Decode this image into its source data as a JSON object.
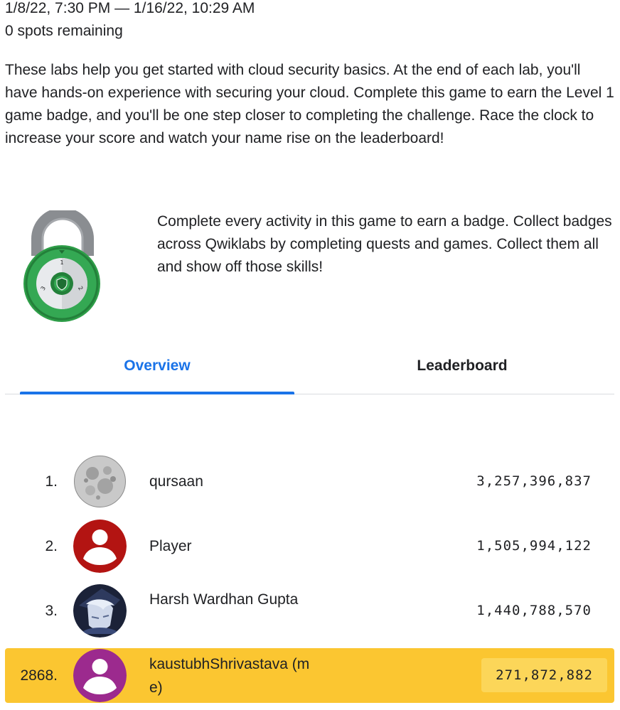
{
  "event": {
    "dates": "1/8/22, 7:30 PM — 1/16/22, 10:29 AM",
    "spots": "0 spots remaining",
    "description": "These labs help you get started with cloud security basics. At the end of each lab, you'll have hands-on experience with securing your cloud. Complete this game to earn the Level 1 game badge, and you'll be one step closer to completing the challenge. Race the clock to increase your score and watch your name rise on the leaderboard!"
  },
  "badge": {
    "icon": "padlock-badge-icon",
    "dial_numbers": [
      "1",
      "2",
      "3"
    ],
    "text": "Complete every activity in this game to earn a badge. Collect badges across Qwiklabs by completing quests and games. Collect them all and show off those skills!"
  },
  "tabs": [
    {
      "label": "Overview",
      "active": true
    },
    {
      "label": "Leaderboard",
      "active": false
    }
  ],
  "colors": {
    "accent": "#1a73e8",
    "highlight": "#fbc631",
    "badge_green": "#2e9e48"
  },
  "leaderboard": [
    {
      "rank": "1.",
      "name": "qursaan",
      "score": "3,257,396,837",
      "avatar": "moon-avatar-icon"
    },
    {
      "rank": "2.",
      "name": "Player",
      "score": "1,505,994,122",
      "avatar": "default-user-avatar-red-icon"
    },
    {
      "rank": "3.",
      "name": "Harsh Wardhan Gupta",
      "score": "1,440,788,570",
      "avatar": "anime-character-avatar-icon"
    },
    {
      "rank": "2868.",
      "name": "kaustubhShrivastava (me)",
      "score": "271,872,882",
      "avatar": "default-user-avatar-purple-icon",
      "is_me": true
    }
  ]
}
